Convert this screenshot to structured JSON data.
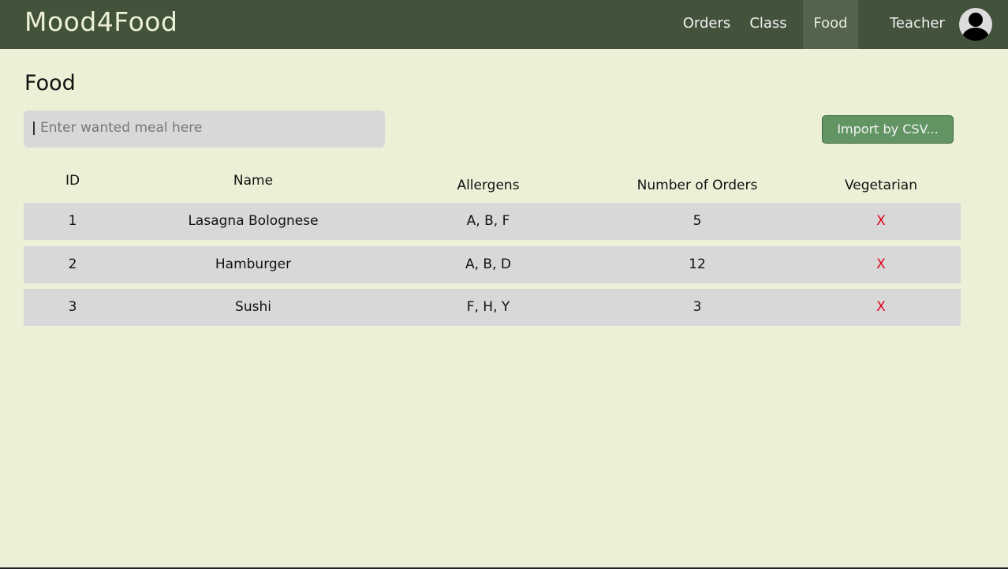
{
  "app": {
    "brand": "Mood4Food"
  },
  "nav": {
    "items": [
      {
        "label": "Orders"
      },
      {
        "label": "Class"
      },
      {
        "label": "Food"
      }
    ],
    "active": "Food",
    "user_label": "Teacher",
    "avatar_icon": "user-avatar-icon"
  },
  "page": {
    "title": "Food"
  },
  "search": {
    "placeholder": "Enter wanted meal here",
    "value": ""
  },
  "import_button": {
    "label": "Import by CSV..."
  },
  "table": {
    "headers": [
      "ID",
      "Name",
      "Allergens",
      "Number of Orders",
      "Vegetarian"
    ],
    "rows": [
      {
        "id": "1",
        "name": "Lasagna Bolognese",
        "allergens": "A, B, F",
        "orders": "5",
        "vegetarian": "X"
      },
      {
        "id": "2",
        "name": "Hamburger",
        "allergens": "A, B, D",
        "orders": "12",
        "vegetarian": "X"
      },
      {
        "id": "3",
        "name": "Sushi",
        "allergens": "F, H, Y",
        "orders": "3",
        "vegetarian": "X"
      }
    ]
  },
  "colors": {
    "navbar": "#43523b",
    "background": "#ecf0d6",
    "row": "#d8d8d8",
    "button": "#639564",
    "not_vegetarian": "#e0001a"
  }
}
